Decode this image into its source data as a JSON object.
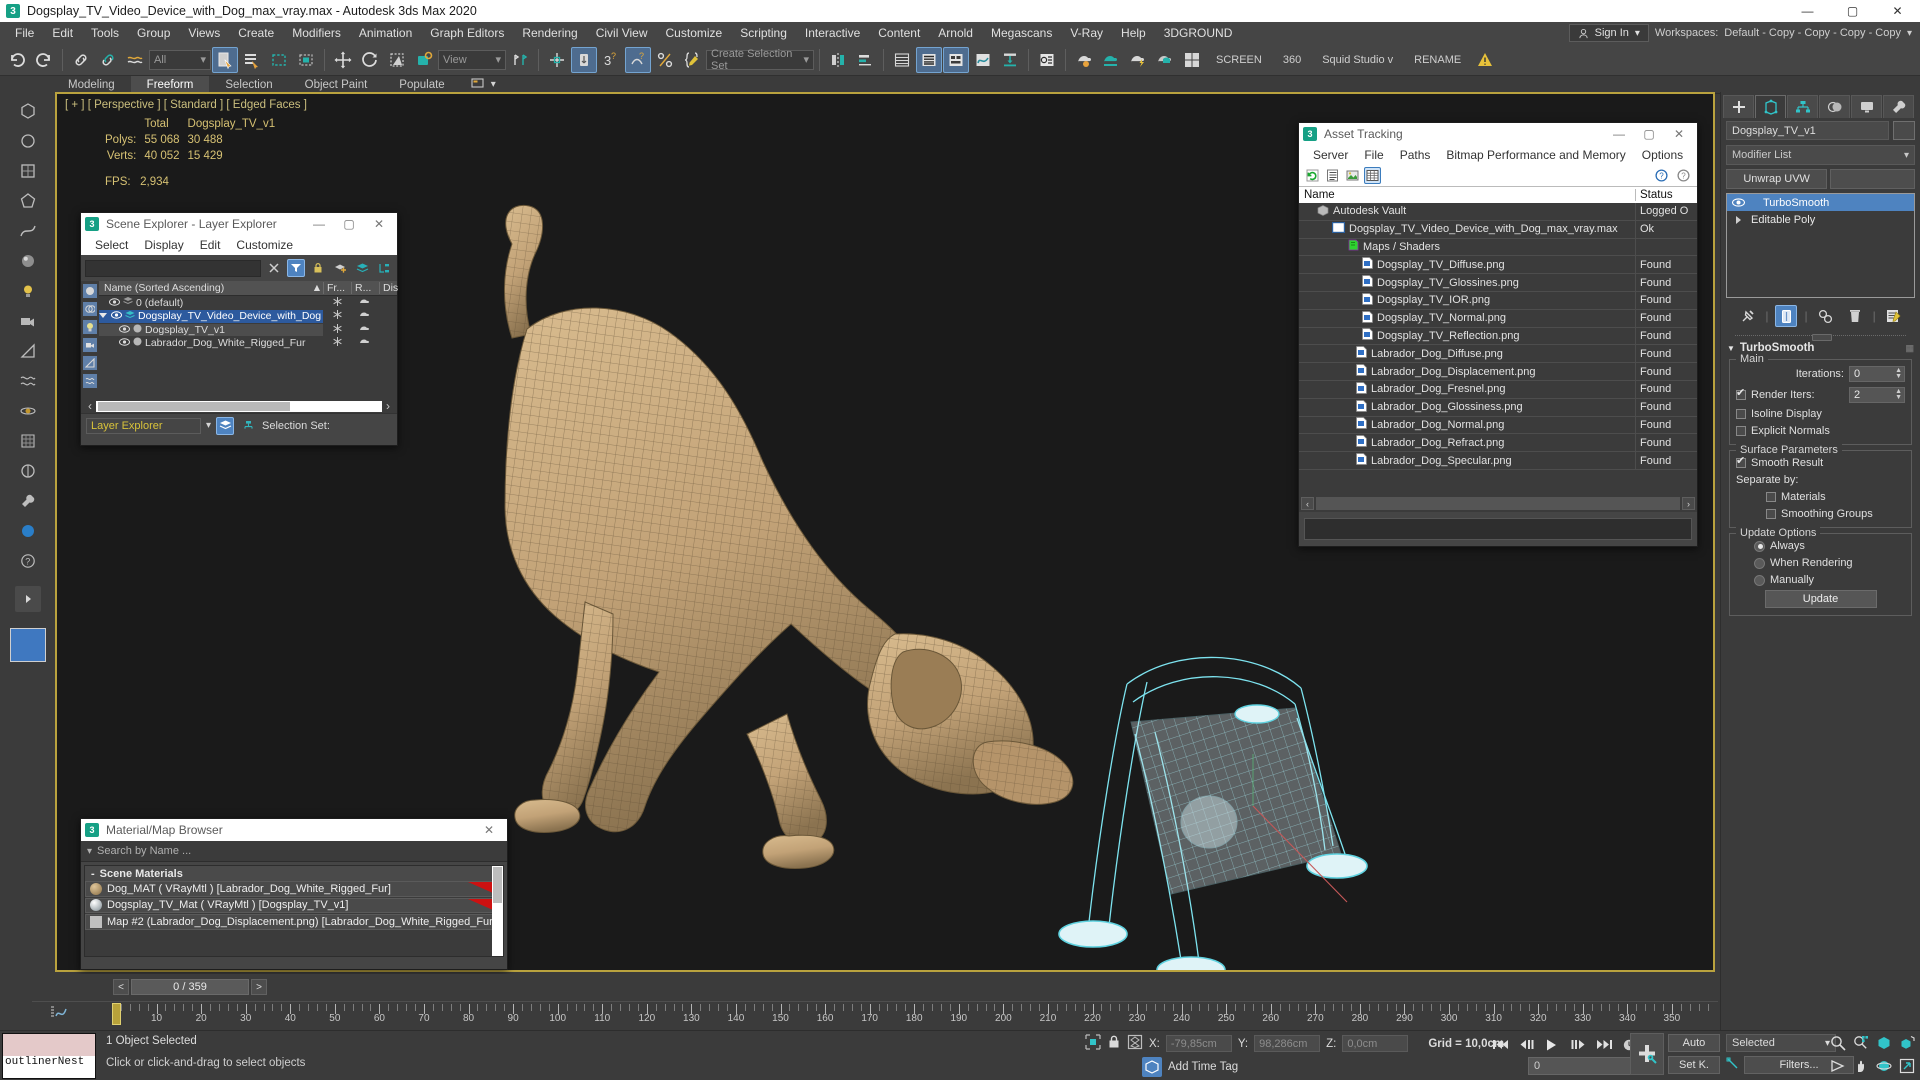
{
  "window": {
    "title": "Dogsplay_TV_Video_Device_with_Dog_max_vray.max - Autodesk 3ds Max 2020",
    "app_icon": "3ds-max-icon",
    "minimize": "—",
    "maximize": "▢",
    "close": "✕"
  },
  "menubar": {
    "items": [
      "File",
      "Edit",
      "Tools",
      "Group",
      "Views",
      "Create",
      "Modifiers",
      "Animation",
      "Graph Editors",
      "Rendering",
      "Civil View",
      "Customize",
      "Scripting",
      "Interactive",
      "Content",
      "Arnold",
      "Megascans",
      "V-Ray",
      "Help",
      "3DGROUND"
    ],
    "sign_in": "Sign In",
    "workspaces_label": "Workspaces:",
    "workspace_value": "Default - Copy - Copy - Copy - Copy"
  },
  "toolbar": {
    "selection_filter": "All",
    "reference_coord": "View",
    "named_selection_set": "Create Selection Set",
    "screen_label": "SCREEN",
    "count_label": "360",
    "studio_label": "Squid Studio v",
    "rename_label": "RENAME",
    "warn_icon": "warning-icon"
  },
  "ribbon": {
    "tabs": [
      "Modeling",
      "Freeform",
      "Selection",
      "Object Paint",
      "Populate"
    ],
    "active": "Freeform"
  },
  "viewport": {
    "label": "[ + ] [ Perspective ] [ Standard ] [ Edged Faces ]",
    "stats_headers": [
      "",
      "Total",
      "Dogsplay_TV_v1"
    ],
    "stats_rows": [
      {
        "label": "Polys:",
        "total": "55 068",
        "object": "30 488"
      },
      {
        "label": "Verts:",
        "total": "40 052",
        "object": "15 429"
      }
    ],
    "fps_label": "FPS:",
    "fps_value": "2,934"
  },
  "scene_explorer": {
    "title": "Scene Explorer - Layer Explorer",
    "menu": [
      "Select",
      "Display",
      "Edit",
      "Customize"
    ],
    "search_value": "",
    "column_headers": [
      "Name (Sorted Ascending)",
      "Fr...",
      "R...",
      "Dis"
    ],
    "rows": [
      {
        "name": "0 (default)",
        "indent": 1,
        "type": "layer",
        "selected": false
      },
      {
        "name": "Dogsplay_TV_Video_Device_with_Dog",
        "indent": 1,
        "type": "layer",
        "selected": true,
        "expanded": true
      },
      {
        "name": "Dogsplay_TV_v1",
        "indent": 2,
        "type": "object",
        "selected": false,
        "highlight": true
      },
      {
        "name": "Labrador_Dog_White_Rigged_Fur",
        "indent": 2,
        "type": "object",
        "selected": false
      }
    ],
    "mode_combo": "Layer Explorer",
    "selection_set_label": "Selection Set:"
  },
  "asset_tracking": {
    "title": "Asset Tracking",
    "menu": [
      "Server",
      "File",
      "Paths",
      "Bitmap Performance and Memory",
      "Options"
    ],
    "column_headers": [
      "Name",
      "Status"
    ],
    "rows": [
      {
        "name": "Autodesk Vault",
        "status": "Logged O",
        "indent": 1,
        "icon": "vault-icon"
      },
      {
        "name": "Dogsplay_TV_Video_Device_with_Dog_max_vray.max",
        "status": "Ok",
        "indent": 2,
        "icon": "scene-file-icon"
      },
      {
        "name": "Maps / Shaders",
        "status": "",
        "indent": 3,
        "icon": "maps-icon"
      },
      {
        "name": "Dogsplay_TV_Diffuse.png",
        "status": "Found",
        "indent": 4,
        "icon": "bitmap-icon"
      },
      {
        "name": "Dogsplay_TV_Glossines.png",
        "status": "Found",
        "indent": 4,
        "icon": "bitmap-icon"
      },
      {
        "name": "Dogsplay_TV_IOR.png",
        "status": "Found",
        "indent": 4,
        "icon": "bitmap-icon"
      },
      {
        "name": "Dogsplay_TV_Normal.png",
        "status": "Found",
        "indent": 4,
        "icon": "bitmap-icon"
      },
      {
        "name": "Dogsplay_TV_Reflection.png",
        "status": "Found",
        "indent": 4,
        "icon": "bitmap-icon"
      },
      {
        "name": "Labrador_Dog_Diffuse.png",
        "status": "Found",
        "indent": 4,
        "icon": "bitmap-icon"
      },
      {
        "name": "Labrador_Dog_Displacement.png",
        "status": "Found",
        "indent": 4,
        "icon": "bitmap-icon"
      },
      {
        "name": "Labrador_Dog_Fresnel.png",
        "status": "Found",
        "indent": 4,
        "icon": "bitmap-icon"
      },
      {
        "name": "Labrador_Dog_Glossiness.png",
        "status": "Found",
        "indent": 4,
        "icon": "bitmap-icon"
      },
      {
        "name": "Labrador_Dog_Normal.png",
        "status": "Found",
        "indent": 4,
        "icon": "bitmap-icon"
      },
      {
        "name": "Labrador_Dog_Refract.png",
        "status": "Found",
        "indent": 4,
        "icon": "bitmap-icon"
      },
      {
        "name": "Labrador_Dog_Specular.png",
        "status": "Found",
        "indent": 4,
        "icon": "bitmap-icon"
      }
    ],
    "path_field_value": ""
  },
  "material_browser": {
    "title": "Material/Map Browser",
    "search_placeholder": "Search by Name ...",
    "group_label": "Scene Materials",
    "rows": [
      {
        "label": "Dog_MAT  ( VRayMtl )  [Labrador_Dog_White_Rigged_Fur]",
        "swatch": "#b89a6b",
        "flag": true
      },
      {
        "label": "Dogsplay_TV_Mat  ( VRayMtl )  [Dogsplay_TV_v1]",
        "swatch": "#cfd6dc",
        "flag": true
      },
      {
        "label": "Map #2 (Labrador_Dog_Displacement.png)  [Labrador_Dog_White_Rigged_Fur]",
        "swatch": "#bfbfbf",
        "flag": false
      }
    ]
  },
  "command_panel": {
    "tabs": [
      "create-tab",
      "modify-tab",
      "hierarchy-tab",
      "motion-tab",
      "display-tab",
      "utilities-tab"
    ],
    "active_tab": "modify-tab",
    "object_name": "Dogsplay_TV_v1",
    "modifier_list_label": "Modifier List",
    "quick_buttons": [
      "Unwrap UVW",
      ""
    ],
    "stack": [
      {
        "label": "TurboSmooth",
        "selected": true,
        "eye": true
      },
      {
        "label": "Editable Poly",
        "selected": false,
        "eye": false
      }
    ],
    "rollout": {
      "title": "TurboSmooth",
      "main_group": "Main",
      "iterations_label": "Iterations:",
      "iterations_value": "0",
      "render_iters_label": "Render Iters:",
      "render_iters_value": "2",
      "render_iters_checked": true,
      "isoline_label": "Isoline Display",
      "isoline_checked": false,
      "explicit_label": "Explicit Normals",
      "explicit_checked": false,
      "surface_group": "Surface Parameters",
      "smooth_result_label": "Smooth Result",
      "smooth_result_checked": true,
      "separate_label": "Separate by:",
      "materials_label": "Materials",
      "materials_checked": false,
      "smoothing_groups_label": "Smoothing Groups",
      "smoothing_groups_checked": false,
      "update_group": "Update Options",
      "update_options": [
        {
          "label": "Always",
          "selected": true
        },
        {
          "label": "When Rendering",
          "selected": false
        },
        {
          "label": "Manually",
          "selected": false
        }
      ],
      "update_button": "Update"
    }
  },
  "timeline": {
    "prev_arrow": "<",
    "frame_display": "0 / 359",
    "next_arrow": ">",
    "tick_labels": [
      "10",
      "20",
      "30",
      "40",
      "50",
      "60",
      "70",
      "80",
      "90",
      "100",
      "110",
      "120",
      "130",
      "140",
      "150",
      "160",
      "170",
      "180",
      "190",
      "200",
      "210",
      "220",
      "230",
      "240",
      "250",
      "260",
      "270",
      "280",
      "290",
      "300",
      "310",
      "320",
      "330",
      "340",
      "350"
    ],
    "current_frame": 0
  },
  "statusbar": {
    "listener_text": "outlinerNest",
    "message": "1 Object Selected",
    "prompt": "Click or click-and-drag to select objects",
    "x_label": "X:",
    "x_value": "-79,85cm",
    "y_label": "Y:",
    "y_value": "98,286cm",
    "z_label": "Z:",
    "z_value": "0,0cm",
    "grid_label": "Grid = 10,0cm",
    "add_time_tag": "Add Time Tag",
    "auto_key": "Auto",
    "set_key": "Set K.",
    "key_filter_combo": "Selected",
    "filters_button": "Filters...",
    "frame_field": "0"
  },
  "colors": {
    "accent_blue": "#4e83c0",
    "viewport_border": "#b9a23e",
    "panel_bg": "#3b3b3b",
    "teal": "#25b2ab",
    "stat_yellow": "#d6c173"
  }
}
